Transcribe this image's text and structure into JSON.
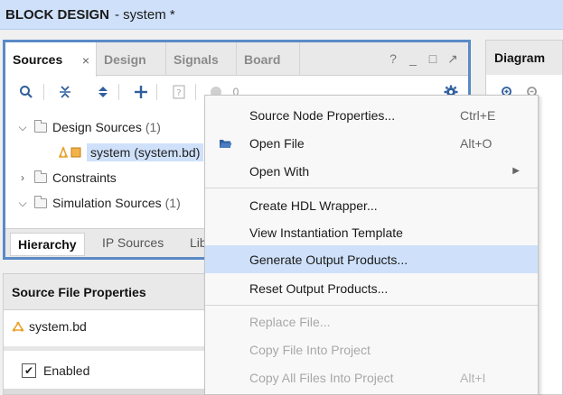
{
  "title": {
    "main": "BLOCK DESIGN",
    "sub": "- system *"
  },
  "sources": {
    "tabs": [
      {
        "label": "Sources",
        "active": true,
        "close": "×"
      },
      {
        "label": "Design"
      },
      {
        "label": "Signals"
      },
      {
        "label": "Board"
      }
    ],
    "window_controls": [
      "?",
      "_",
      "□",
      "↗"
    ],
    "toolbar": {
      "icons": [
        "search-icon",
        "collapse-all-icon",
        "expand-all-icon",
        "add-icon",
        "properties-icon",
        "status-circle-icon",
        "gear-icon"
      ],
      "count": "0"
    },
    "tree": [
      {
        "label": "Design Sources",
        "count": "(1)",
        "expanded": true
      },
      {
        "label": "system (system.bd)",
        "selected": true
      },
      {
        "label": "Constraints",
        "expanded": false
      },
      {
        "label": "Simulation Sources",
        "count": "(1)",
        "expanded": true
      }
    ],
    "bottom_tabs": [
      "Hierarchy",
      "IP Sources",
      "Lib"
    ]
  },
  "sfp": {
    "title": "Source File Properties",
    "file": "system.bd",
    "enabled_label": "Enabled",
    "enabled": true
  },
  "diagram": {
    "title": "Diagram"
  },
  "menu": {
    "items": [
      {
        "label": "Source Node Properties...",
        "accel": "Ctrl+E"
      },
      {
        "label": "Open File",
        "accel": "Alt+O",
        "icon": "open-folder-icon"
      },
      {
        "label": "Open With",
        "submenu": true
      },
      {
        "label": "Create HDL Wrapper..."
      },
      {
        "label": "View Instantiation Template"
      },
      {
        "label": "Generate Output Products...",
        "highlighted": true
      },
      {
        "label": "Reset Output Products..."
      },
      {
        "label": "Replace File...",
        "disabled": true
      },
      {
        "label": "Copy File Into Project",
        "disabled": true
      },
      {
        "label": "Copy All Files Into Project",
        "accel": "Alt+I",
        "disabled": true
      }
    ]
  },
  "colors": {
    "accent": "#5a8ac6",
    "highlight": "#cfe1fa",
    "icon_blue": "#2f5f9e",
    "bd_orange": "#e8a32a"
  }
}
